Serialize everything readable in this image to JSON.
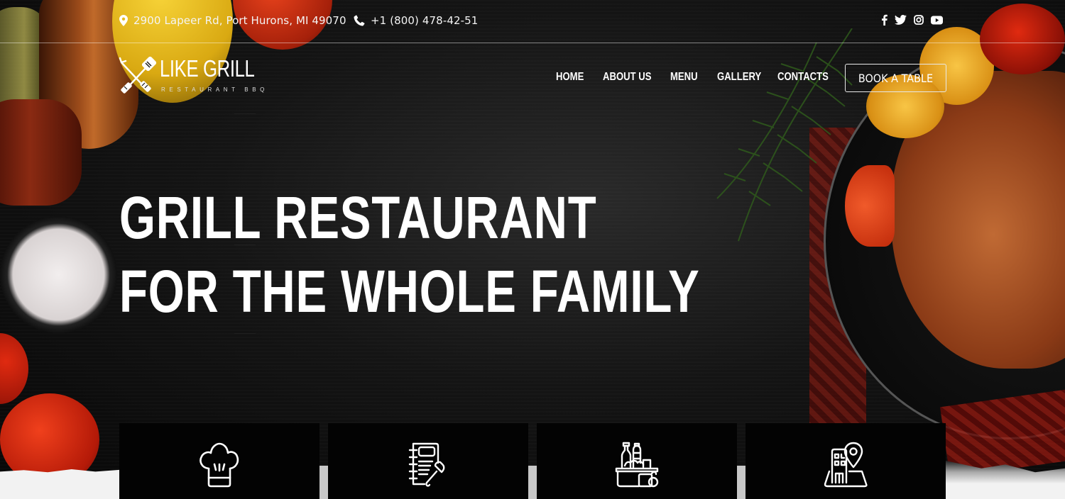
{
  "topbar": {
    "address": "2900 Lapeer Rd, Port Hurons, MI 49070",
    "phone": "+1 (800) 478-42-51",
    "address_icon": "map-marker-icon",
    "phone_icon": "phone-icon",
    "social": [
      {
        "name": "facebook",
        "icon": "facebook-icon"
      },
      {
        "name": "twitter",
        "icon": "twitter-icon"
      },
      {
        "name": "instagram",
        "icon": "instagram-icon"
      },
      {
        "name": "youtube",
        "icon": "youtube-icon"
      }
    ]
  },
  "logo": {
    "title": "LIKE GRILL",
    "subtitle": "RESTAURANT BBQ",
    "icon": "crossed-fork-spatula-icon"
  },
  "nav": {
    "items": [
      {
        "label": "HOME"
      },
      {
        "label": "ABOUT US"
      },
      {
        "label": "MENU"
      },
      {
        "label": "GALLERY"
      },
      {
        "label": "CONTACTS"
      }
    ],
    "cta": "BOOK A TABLE"
  },
  "hero": {
    "line1": "GRILL RESTAURANT",
    "line2": "FOR THE WHOLE FAMILY"
  },
  "features": [
    {
      "icon": "chef-hat-icon"
    },
    {
      "icon": "menu-book-icon"
    },
    {
      "icon": "grocery-basket-icon"
    },
    {
      "icon": "building-location-icon"
    }
  ],
  "colors": {
    "background": "#0a0a0a",
    "text": "#ffffff",
    "card": "#030303",
    "paper": "#f2f2f2"
  }
}
